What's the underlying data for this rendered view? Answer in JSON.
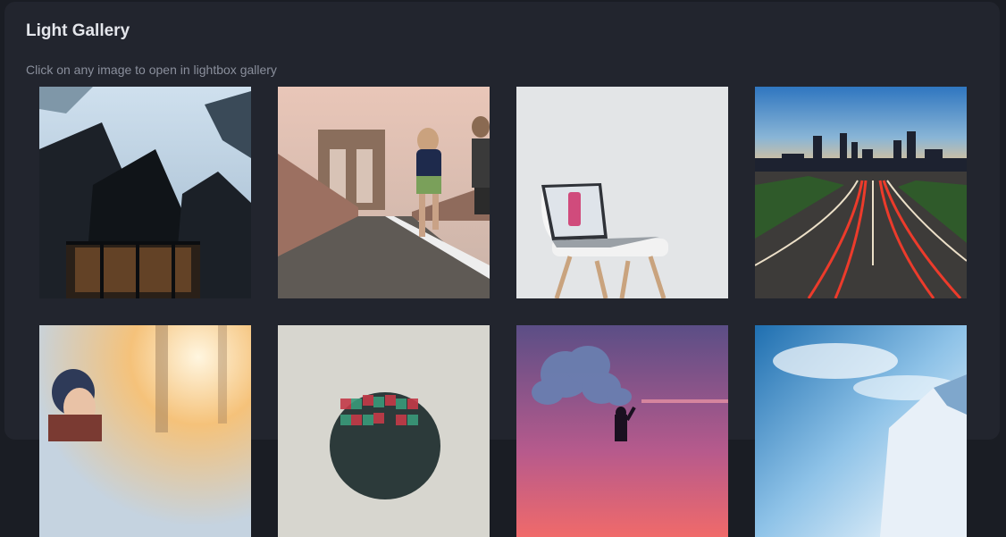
{
  "gallery": {
    "title": "Light Gallery",
    "subtitle": "Click on any image to open in lightbox gallery"
  },
  "images": [
    {
      "name": "gallery-image-skyscrapers"
    },
    {
      "name": "gallery-image-bridge-runners"
    },
    {
      "name": "gallery-image-laptop-chair"
    },
    {
      "name": "gallery-image-city-highway-night"
    },
    {
      "name": "gallery-image-woman-snow"
    },
    {
      "name": "gallery-image-hot-air-balloon"
    },
    {
      "name": "gallery-image-smoke-flare"
    },
    {
      "name": "gallery-image-snowy-mountain"
    }
  ],
  "theme": {
    "page_background": "#1a1d24",
    "card_background": "#22252e",
    "title_color": "#e4e6eb",
    "subtitle_color": "#8a8f9c"
  }
}
